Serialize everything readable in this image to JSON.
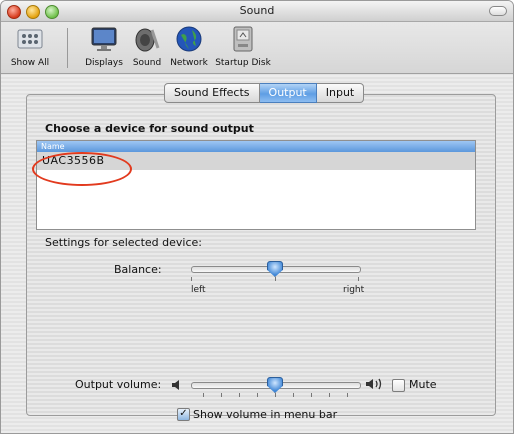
{
  "window": {
    "title": "Sound"
  },
  "toolbar": {
    "items": [
      {
        "label": "Show All",
        "icon": "apple-icon"
      },
      {
        "label": "Displays",
        "icon": "display-icon"
      },
      {
        "label": "Sound",
        "icon": "speaker-icon"
      },
      {
        "label": "Network",
        "icon": "globe-icon"
      },
      {
        "label": "Startup Disk",
        "icon": "disk-icon"
      }
    ]
  },
  "tabs": [
    {
      "label": "Sound Effects",
      "active": false
    },
    {
      "label": "Output",
      "active": true
    },
    {
      "label": "Input",
      "active": false
    }
  ],
  "output": {
    "heading": "Choose a device for sound output",
    "column_name": "Name",
    "devices": [
      "UAC3556B"
    ],
    "settings_heading": "Settings for selected device:",
    "balance_label": "Balance:",
    "balance_left": "left",
    "balance_right": "right",
    "balance_value": 0.5
  },
  "volume": {
    "label": "Output volume:",
    "level": 0.5,
    "mute_label": "Mute",
    "mute_checked": false,
    "show_in_menubar_label": "Show volume in menu bar",
    "show_in_menubar_checked": true
  },
  "colors": {
    "highlight": "#e23a1e",
    "accent": "#5f9ee4"
  }
}
